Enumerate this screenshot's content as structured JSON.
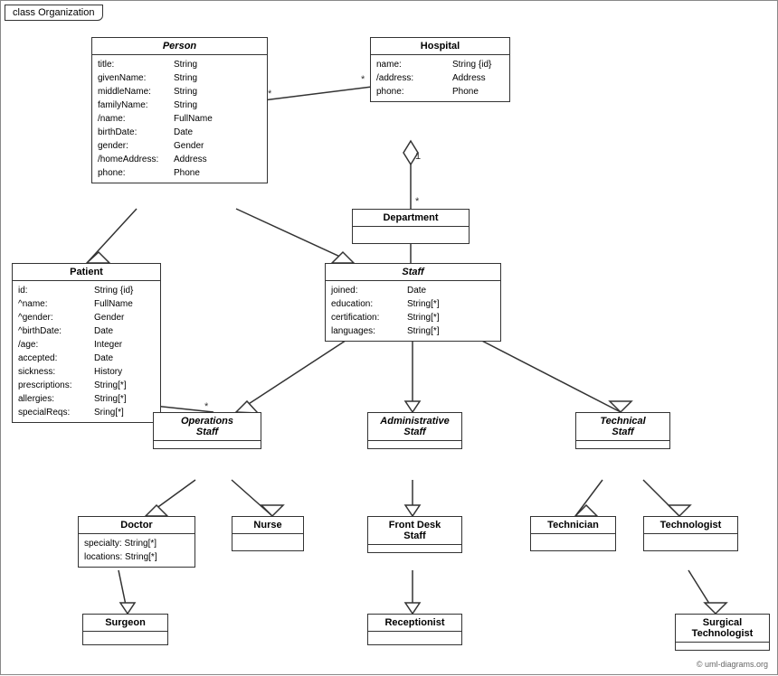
{
  "title": "class Organization",
  "copyright": "© uml-diagrams.org",
  "classes": {
    "person": {
      "name": "Person",
      "italic": true,
      "attrs": [
        [
          "title:",
          "String"
        ],
        [
          "givenName:",
          "String"
        ],
        [
          "middleName:",
          "String"
        ],
        [
          "familyName:",
          "String"
        ],
        [
          "/name:",
          "FullName"
        ],
        [
          "birthDate:",
          "Date"
        ],
        [
          "gender:",
          "Gender"
        ],
        [
          "/homeAddress:",
          "Address"
        ],
        [
          "phone:",
          "Phone"
        ]
      ]
    },
    "hospital": {
      "name": "Hospital",
      "italic": false,
      "attrs": [
        [
          "name:",
          "String {id}"
        ],
        [
          "/address:",
          "Address"
        ],
        [
          "phone:",
          "Phone"
        ]
      ]
    },
    "patient": {
      "name": "Patient",
      "italic": false,
      "attrs": [
        [
          "id:",
          "String {id}"
        ],
        [
          "^name:",
          "FullName"
        ],
        [
          "^gender:",
          "Gender"
        ],
        [
          "^birthDate:",
          "Date"
        ],
        [
          "/age:",
          "Integer"
        ],
        [
          "accepted:",
          "Date"
        ],
        [
          "sickness:",
          "History"
        ],
        [
          "prescriptions:",
          "String[*]"
        ],
        [
          "allergies:",
          "String[*]"
        ],
        [
          "specialReqs:",
          "Sring[*]"
        ]
      ]
    },
    "department": {
      "name": "Department",
      "italic": false,
      "attrs": []
    },
    "staff": {
      "name": "Staff",
      "italic": true,
      "attrs": [
        [
          "joined:",
          "Date"
        ],
        [
          "education:",
          "String[*]"
        ],
        [
          "certification:",
          "String[*]"
        ],
        [
          "languages:",
          "String[*]"
        ]
      ]
    },
    "operations_staff": {
      "name": "Operations Staff",
      "italic": true,
      "attrs": []
    },
    "administrative_staff": {
      "name": "Administrative Staff",
      "italic": true,
      "attrs": []
    },
    "technical_staff": {
      "name": "Technical Staff",
      "italic": true,
      "attrs": []
    },
    "doctor": {
      "name": "Doctor",
      "italic": false,
      "attrs": [
        [
          "specialty:",
          "String[*]"
        ],
        [
          "locations:",
          "String[*]"
        ]
      ]
    },
    "nurse": {
      "name": "Nurse",
      "italic": false,
      "attrs": []
    },
    "front_desk_staff": {
      "name": "Front Desk Staff",
      "italic": false,
      "attrs": []
    },
    "technician": {
      "name": "Technician",
      "italic": false,
      "attrs": []
    },
    "technologist": {
      "name": "Technologist",
      "italic": false,
      "attrs": []
    },
    "surgeon": {
      "name": "Surgeon",
      "italic": false,
      "attrs": []
    },
    "receptionist": {
      "name": "Receptionist",
      "italic": false,
      "attrs": []
    },
    "surgical_technologist": {
      "name": "Surgical Technologist",
      "italic": false,
      "attrs": []
    }
  }
}
